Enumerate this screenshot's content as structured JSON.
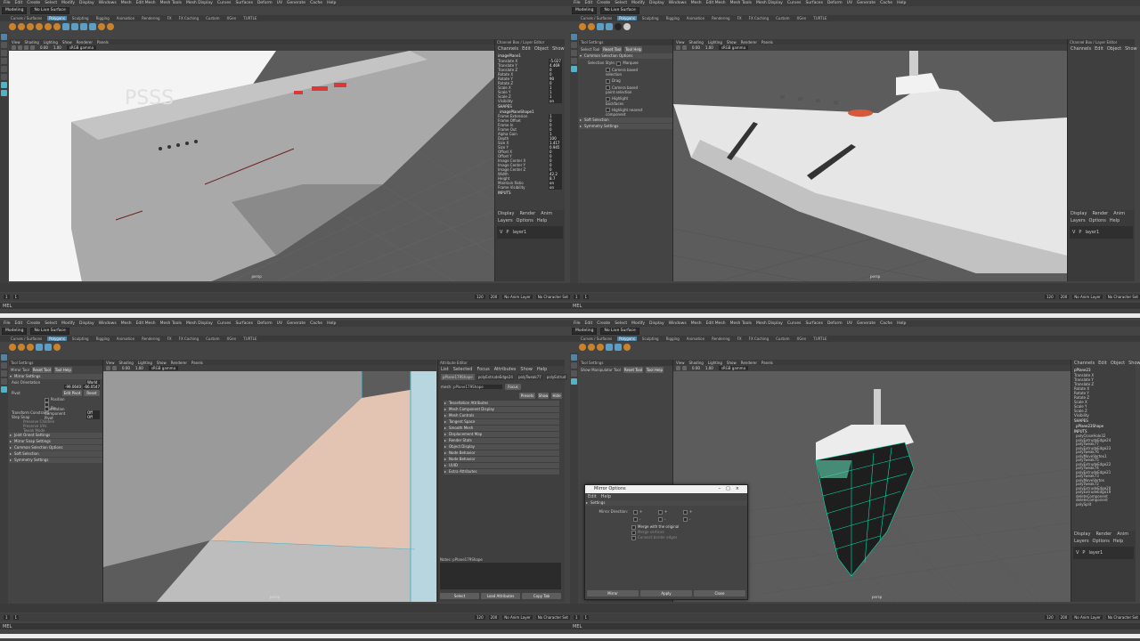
{
  "menus": [
    "File",
    "Edit",
    "Create",
    "Select",
    "Modify",
    "Display",
    "Windows",
    "Mesh",
    "Edit Mesh",
    "Mesh Tools",
    "Mesh Display",
    "Curves",
    "Surfaces",
    "Deform",
    "UV",
    "Generate",
    "Cache",
    "Help"
  ],
  "workspace": "Modeling",
  "live_surface": "No Live Surface",
  "shelf_tabs": [
    "Curves / Surfaces",
    "Polygons",
    "Sculpting",
    "Rigging",
    "Animation",
    "Rendering",
    "FX",
    "FX Caching",
    "Custom",
    "XGen",
    "TURTLE"
  ],
  "viewport_menu": [
    "View",
    "Shading",
    "Lighting",
    "Show",
    "Renderer",
    "Panels"
  ],
  "viewport_values": {
    "near": "0.00",
    "far": "1.00",
    "color": "sRGB gamma"
  },
  "camera": "persp",
  "channel_box": {
    "header": "Channel Box / Layer Editor",
    "menus": [
      "Channels",
      "Edit",
      "Object",
      "Show"
    ],
    "object": "imagePlane1",
    "attrs": [
      {
        "k": "Translate X",
        "v": "-5.027"
      },
      {
        "k": "Translate Y",
        "v": "4.469"
      },
      {
        "k": "Translate Z",
        "v": "0"
      },
      {
        "k": "Rotate X",
        "v": "0"
      },
      {
        "k": "Rotate Y",
        "v": "90"
      },
      {
        "k": "Rotate Z",
        "v": "0"
      },
      {
        "k": "Scale X",
        "v": "1"
      },
      {
        "k": "Scale Y",
        "v": "1"
      },
      {
        "k": "Scale Z",
        "v": "1"
      },
      {
        "k": "Visibility",
        "v": "on"
      }
    ],
    "shapes_label": "SHAPES",
    "shape_name": "imagePlaneShape1",
    "shape_attrs": [
      {
        "k": "Frame Extension",
        "v": "1"
      },
      {
        "k": "Frame Offset",
        "v": "0"
      },
      {
        "k": "Frame In",
        "v": "0"
      },
      {
        "k": "Frame Out",
        "v": "0"
      },
      {
        "k": "Alpha Gain",
        "v": "1"
      },
      {
        "k": "Depth",
        "v": "100"
      },
      {
        "k": "Size X",
        "v": "1.417"
      },
      {
        "k": "Size Y",
        "v": "0.945"
      },
      {
        "k": "Offset X",
        "v": "0"
      },
      {
        "k": "Offset Y",
        "v": "0"
      },
      {
        "k": "Image Center X",
        "v": "0"
      },
      {
        "k": "Image Center Y",
        "v": "0"
      },
      {
        "k": "Image Center Z",
        "v": "0"
      },
      {
        "k": "Width",
        "v": "42.2"
      },
      {
        "k": "Height",
        "v": "8.7"
      },
      {
        "k": "Maintain Ratio",
        "v": "on"
      },
      {
        "k": "Frame Visibility",
        "v": "on"
      }
    ],
    "inputs_label": "INPUTS"
  },
  "layer_editor": {
    "tabs": [
      "Display",
      "Render",
      "Anim"
    ],
    "menus": [
      "Layers",
      "Options",
      "Help"
    ],
    "layer": "layer1",
    "v": "V",
    "p": "P"
  },
  "tool_settings_tr": {
    "title": "Tool Settings",
    "tool": "Select Tool",
    "reset": "Reset Tool",
    "help": "Tool Help",
    "section": "Common Selection Options",
    "style_label": "Selection Style:",
    "style_value": "Marquee",
    "options": [
      "Camera based selection",
      "Drag",
      "Camera based paint selection",
      "Highlight backfaces",
      "Highlight nearest component"
    ],
    "sections": [
      "Soft Selection",
      "Symmetry Settings"
    ]
  },
  "tool_settings_bl": {
    "title": "Tool Settings",
    "tool": "Mirror Tool",
    "reset": "Reset Tool",
    "help": "Tool Help",
    "section_open": "Mirror Settings",
    "axis_orientation_label": "Axis Orientation",
    "axis_orientation_value": "World",
    "pos_x": "-99.0640",
    "pos_y": "-66.0547",
    "pivot_label": "Pivot",
    "pivot_edit": "Edit Pivot",
    "pivot_reset": "Reset",
    "pivot_options": [
      "Position",
      "Orientation",
      "Pin Component Pivot"
    ],
    "transform_constraint_label": "Transform Constraint",
    "transform_constraint_value": "Off",
    "step_snap_label": "Step Snap",
    "step_snap_value": "Off",
    "extra": [
      "Preserve Children",
      "Preserve UVs",
      "Tweak Mode"
    ],
    "sections": [
      "Joint Orient Settings",
      "Mirror Snap Settings",
      "Common Selection Options",
      "Soft Selection",
      "Symmetry Settings"
    ]
  },
  "attribute_editor": {
    "title": "Attribute Editor",
    "menus": [
      "List",
      "Selected",
      "Focus",
      "Attributes",
      "Show",
      "Help"
    ],
    "tabs": [
      "pPlane179Shape",
      "polyExtrudeEdge24",
      "polyTweak77",
      "polyExtrud"
    ],
    "mesh_label": "mesh",
    "mesh_value": "pPlane179Shape",
    "focus": "Focus",
    "presets": "Presets",
    "show": "Show",
    "hide": "Hide",
    "sections": [
      "Tessellation Attributes",
      "Mesh Component Display",
      "Mesh Controls",
      "Tangent Space",
      "Smooth Mesh",
      "Displacement Map",
      "Render Stats",
      "Object Display",
      "Node Behavior",
      "Node Behavior",
      "UUID",
      "Extra Attributes"
    ],
    "notes_label": "Notes: pPlane179Shape",
    "buttons": [
      "Select",
      "Load Attributes",
      "Copy Tab"
    ]
  },
  "mirror_dialog": {
    "title": "Mirror Options",
    "menus": [
      "Edit",
      "Help"
    ],
    "group": "Settings",
    "direction_label": "Mirror Direction:",
    "directions": [
      "+",
      "+",
      "+",
      "-",
      "-",
      "-"
    ],
    "options": [
      "Merge with the original",
      "Merge vertices",
      "Connect border edges"
    ],
    "buttons": [
      "Mirror",
      "Apply",
      "Close"
    ]
  },
  "channel_box_br": {
    "menus": [
      "Channels",
      "Edit",
      "Object",
      "Show"
    ],
    "object": "pPlane23",
    "attrs": [
      "Translate X",
      "Translate Y",
      "Translate Z",
      "Rotate X",
      "Rotate Y",
      "Rotate Z",
      "Scale X",
      "Scale Y",
      "Scale Z",
      "Visibility"
    ],
    "shapes_label": "SHAPES",
    "shape_name": "pPlane23Shape",
    "inputs_label": "INPUTS",
    "inputs": [
      "polyCloseHole32",
      "polyExtrudeEdge24",
      "polyTweak77",
      "polyExtrudeEdge23",
      "polyTweak76",
      "polyMoveVertex1",
      "polyTweak75",
      "polyExtrudeEdge22",
      "polyTweak74",
      "polyExtrudeEdge21",
      "polyTweak73",
      "polyMoveVertex",
      "polyTweak72",
      "polyExtrudeEdge20",
      "polyExtrudeEdge19",
      "deleteComponent",
      "deleteComponent",
      "polySplit"
    ]
  },
  "manip_tool": {
    "title": "Tool Settings",
    "tool": "Show Manipulator Tool",
    "reset": "Reset Tool",
    "help": "Tool Help"
  },
  "timeline": {
    "start": "1",
    "end": "120",
    "end2": "200",
    "current": "1",
    "anim_layer": "No Anim Layer",
    "char_set": "No Character Set",
    "mel": "MEL"
  },
  "watermark": "PSSS",
  "colors": {
    "accent": "#5285a6",
    "cyan": "#4fb4c8",
    "wire": "#00e0a8"
  }
}
